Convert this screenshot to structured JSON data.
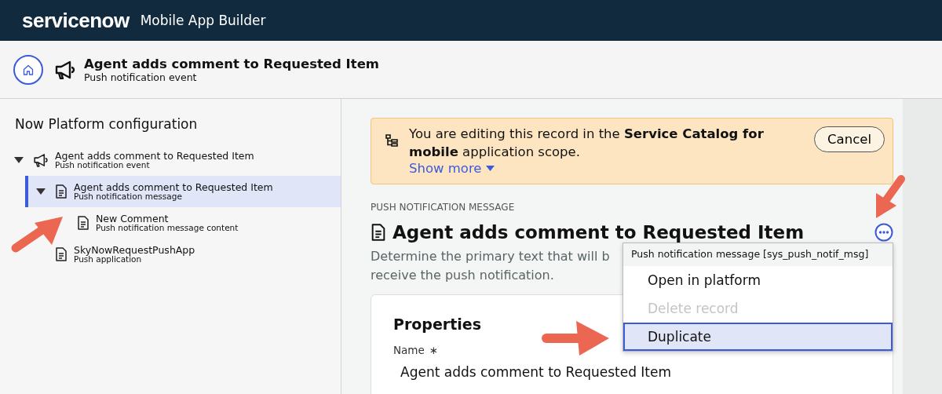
{
  "app_bar": {
    "brand": "servicenow",
    "title": "Mobile App Builder"
  },
  "record_header": {
    "title": "Agent adds comment to Requested Item",
    "subtitle": "Push notification event"
  },
  "sidebar": {
    "title": "Now Platform configuration",
    "tree": [
      {
        "title": "Agent adds comment to Requested Item",
        "subtitle": "Push notification event",
        "kind": "event",
        "expanded": true,
        "selected": false,
        "children": [
          {
            "title": "Agent adds comment to Requested Item",
            "subtitle": "Push notification message",
            "kind": "document",
            "expanded": true,
            "selected": true,
            "children": [
              {
                "title": "New Comment",
                "subtitle": "Push notification message content",
                "kind": "document",
                "selected": false
              }
            ]
          },
          {
            "title": "SkyNowRequestPushApp",
            "subtitle": "Push application",
            "kind": "document",
            "selected": false
          }
        ]
      }
    ]
  },
  "banner": {
    "message": "You are editing this record in the **Service Catalog for mobile** application scope.",
    "link": "Show more",
    "button": "Cancel"
  },
  "record": {
    "section_label": "PUSH NOTIFICATION MESSAGE",
    "title": "Agent adds comment to Requested Item",
    "description_lines": [
      "Determine the primary text that will b",
      "receive the push notification."
    ]
  },
  "properties": {
    "title": "Properties",
    "fields": [
      {
        "label": "Name",
        "required_mark": "∗",
        "value": "Agent adds comment to Requested Item"
      }
    ]
  },
  "menu": {
    "header": "Push notification message [sys_push_notif_msg]",
    "items": [
      {
        "label": "Open in platform",
        "disabled": false,
        "selected": false
      },
      {
        "label": "Delete record",
        "disabled": true,
        "selected": false
      },
      {
        "label": "Duplicate",
        "disabled": false,
        "selected": true
      }
    ]
  }
}
